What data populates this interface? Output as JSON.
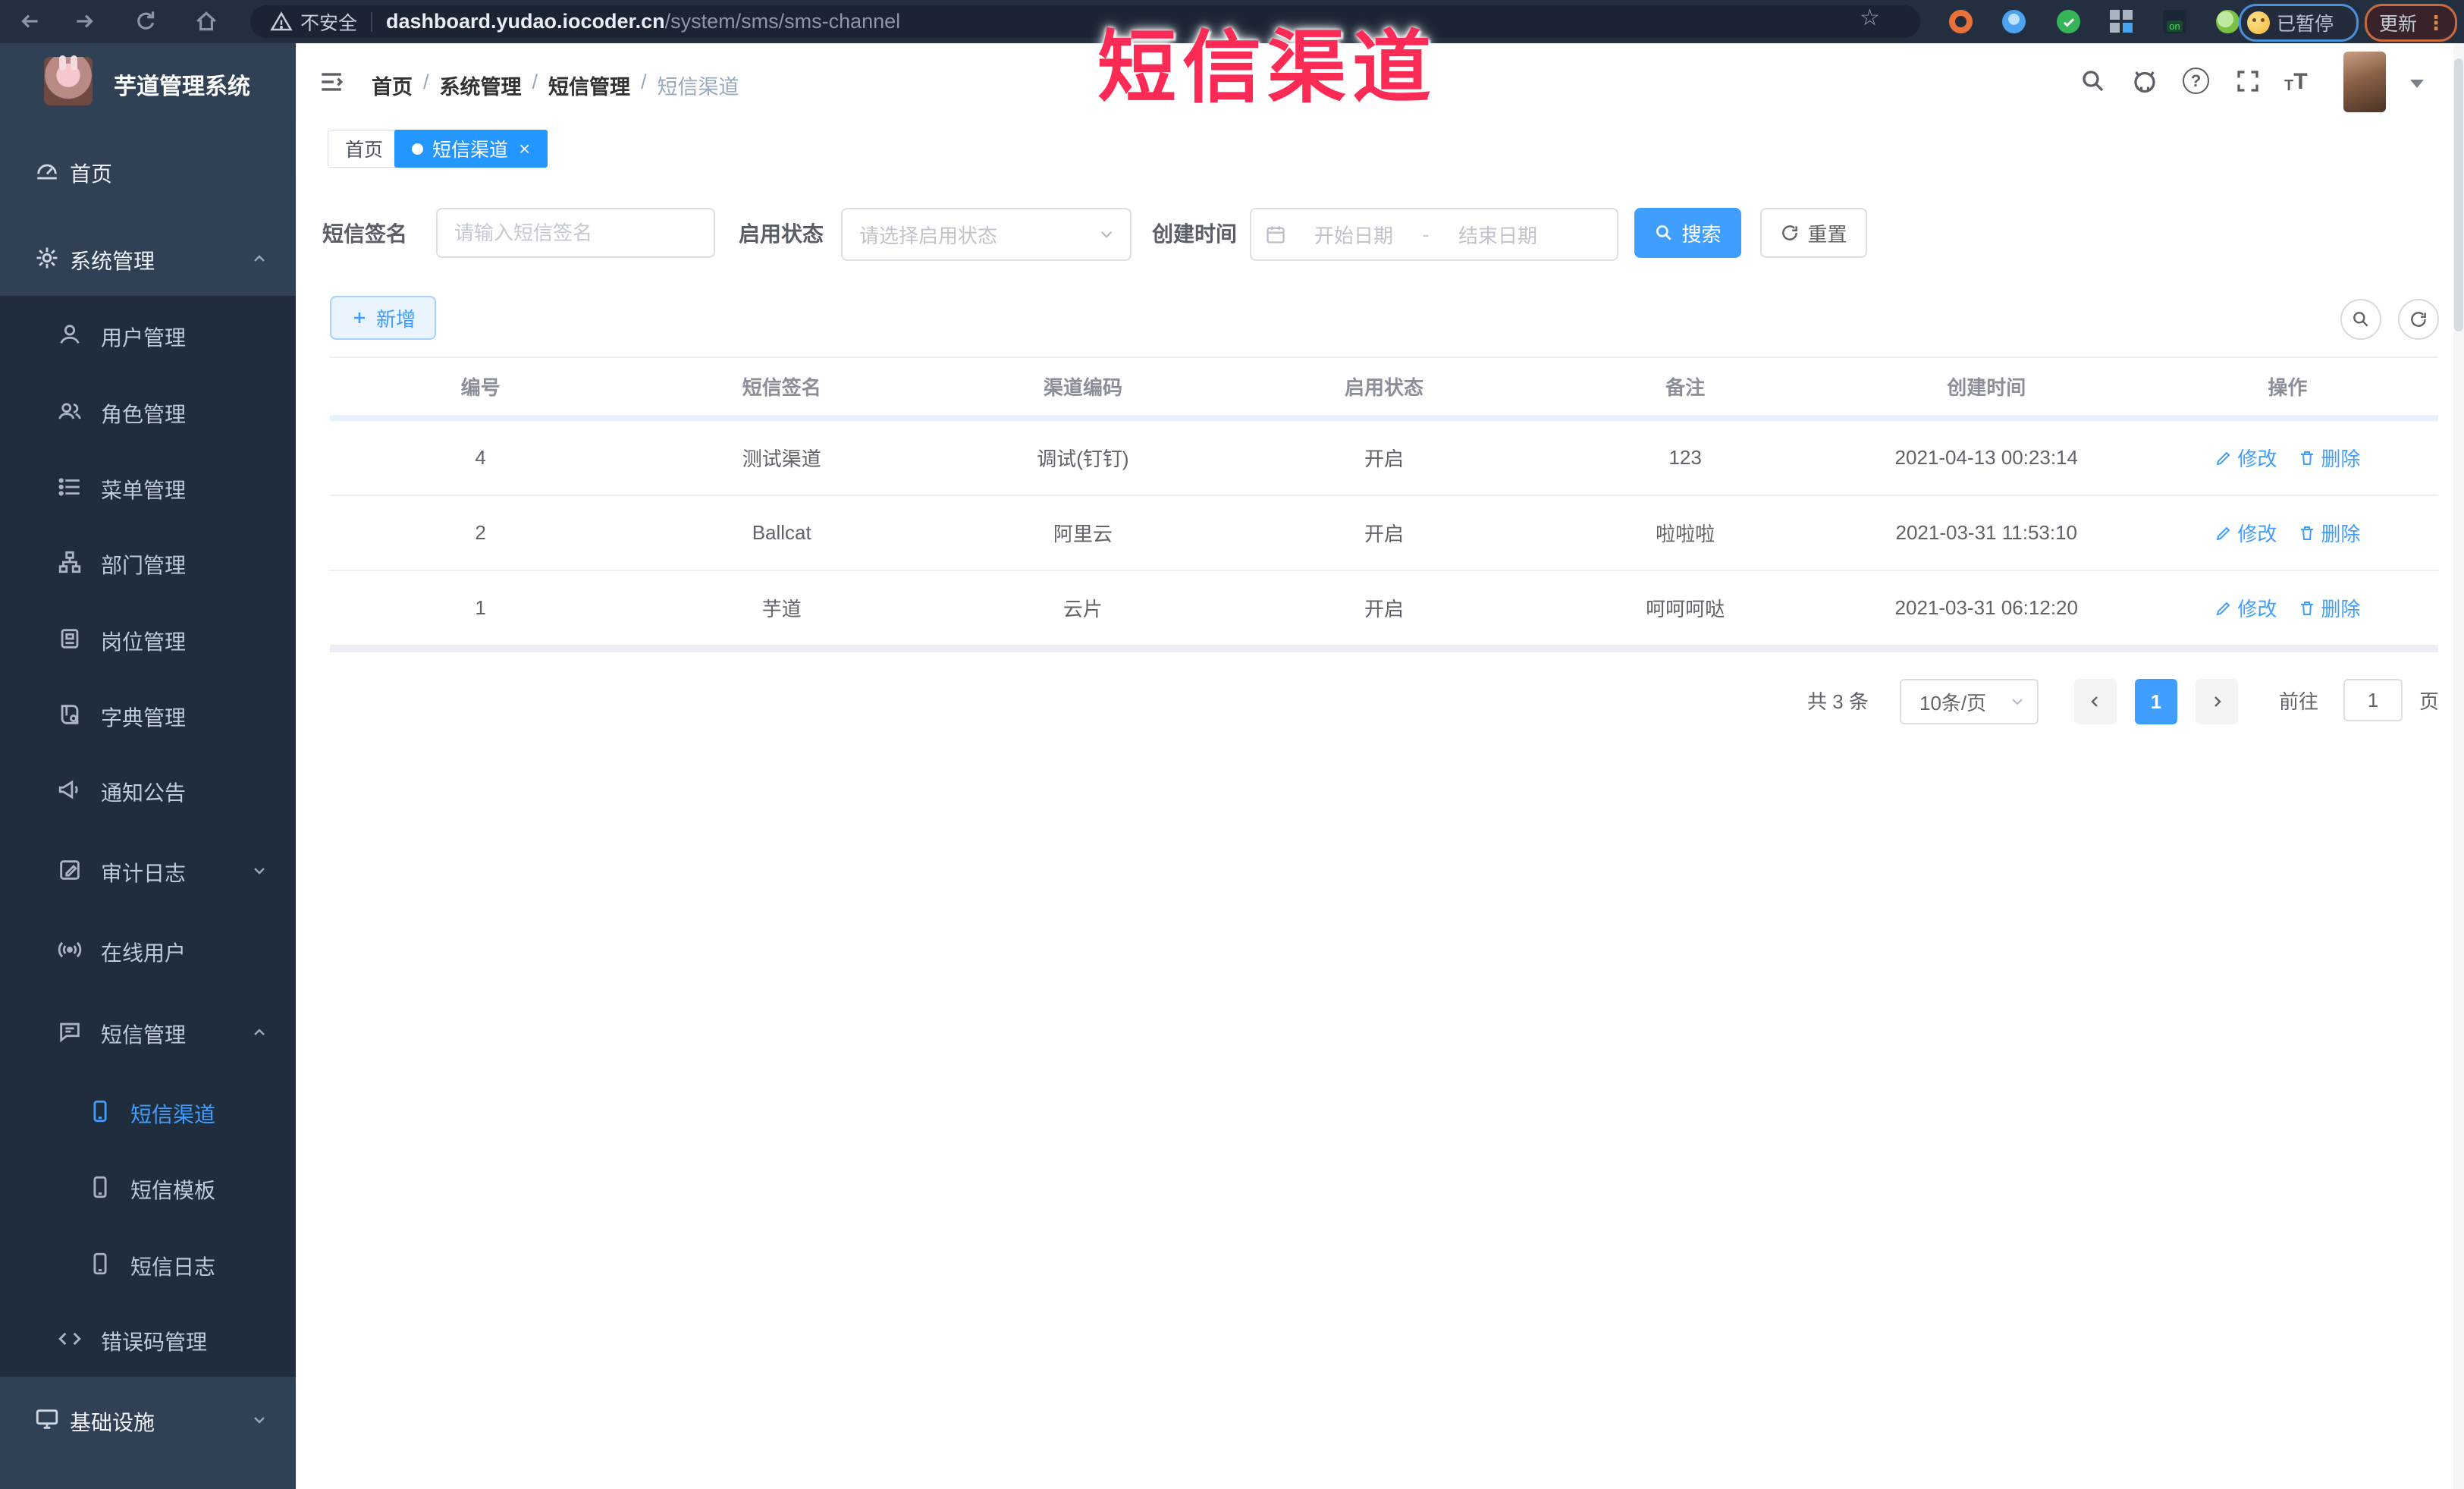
{
  "browser": {
    "security_label": "不安全",
    "url_host": "dashboard.yudao.iocoder.cn",
    "url_path": "/system/sms/sms-channel",
    "paused_badge": "已暂停",
    "update_button": "更新"
  },
  "icons": {
    "slash": "/",
    "close": "×",
    "star": "☆",
    "overflow": "⋮",
    "question": "?",
    "on_label": "on",
    "t_large": "T",
    "t_small": "T"
  },
  "overlay": {
    "title": "短信渠道"
  },
  "sidebar": {
    "app_title": "芋道管理系统",
    "items": [
      {
        "label": "首页"
      },
      {
        "label": "系统管理"
      },
      {
        "label": "用户管理"
      },
      {
        "label": "角色管理"
      },
      {
        "label": "菜单管理"
      },
      {
        "label": "部门管理"
      },
      {
        "label": "岗位管理"
      },
      {
        "label": "字典管理"
      },
      {
        "label": "通知公告"
      },
      {
        "label": "审计日志"
      },
      {
        "label": "在线用户"
      },
      {
        "label": "短信管理"
      },
      {
        "label": "短信渠道"
      },
      {
        "label": "短信模板"
      },
      {
        "label": "短信日志"
      },
      {
        "label": "错误码管理"
      },
      {
        "label": "基础设施"
      }
    ]
  },
  "header": {
    "breadcrumb": [
      "首页",
      "系统管理",
      "短信管理",
      "短信渠道"
    ]
  },
  "tabs": [
    {
      "label": "首页"
    },
    {
      "label": "短信渠道",
      "active": true
    }
  ],
  "filters": {
    "sign_label": "短信签名",
    "sign_placeholder": "请输入短信签名",
    "status_label": "启用状态",
    "status_placeholder": "请选择启用状态",
    "time_label": "创建时间",
    "start_placeholder": "开始日期",
    "range_separator": "-",
    "end_placeholder": "结束日期",
    "search_button": "搜索",
    "reset_button": "重置"
  },
  "toolbar": {
    "add_button": "新增"
  },
  "table": {
    "columns": [
      "编号",
      "短信签名",
      "渠道编码",
      "启用状态",
      "备注",
      "创建时间",
      "操作"
    ],
    "edit_label": "修改",
    "delete_label": "删除",
    "rows": [
      {
        "id": "4",
        "sign": "测试渠道",
        "code": "调试(钉钉)",
        "status": "开启",
        "remark": "123",
        "create_time": "2021-04-13 00:23:14"
      },
      {
        "id": "2",
        "sign": "Ballcat",
        "code": "阿里云",
        "status": "开启",
        "remark": "啦啦啦",
        "create_time": "2021-03-31 11:53:10"
      },
      {
        "id": "1",
        "sign": "芋道",
        "code": "云片",
        "status": "开启",
        "remark": "呵呵呵哒",
        "create_time": "2021-03-31 06:12:20"
      }
    ]
  },
  "pagination": {
    "total_text": "共 3 条",
    "page_size": "10条/页",
    "current_page": "1",
    "goto_label": "前往",
    "goto_value": "1",
    "page_unit": "页"
  },
  "colors": {
    "primary": "#409eff",
    "tab_active": "#2496ff",
    "overlay_red": "#fb2b55",
    "sidebar_bg": "#304156",
    "submenu_bg": "#1f2d3d"
  }
}
